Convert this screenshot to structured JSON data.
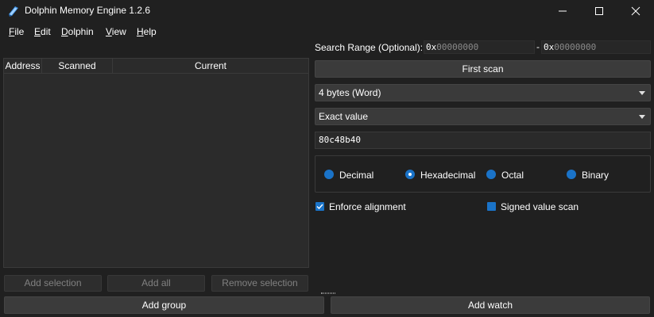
{
  "window": {
    "title": "Dolphin Memory Engine 1.2.6",
    "app_icon": "dolphin-memory-engine-icon",
    "controls": [
      "minimize-icon",
      "maximize-icon",
      "close-icon"
    ]
  },
  "menu": {
    "items": [
      "File",
      "Edit",
      "Dolphin",
      "View",
      "Help"
    ]
  },
  "scan_results_table": {
    "columns": [
      "Address",
      "Scanned",
      "Current"
    ],
    "rows": []
  },
  "left_buttons": {
    "add_selection": "Add selection",
    "add_all": "Add all",
    "remove_selection": "Remove selection"
  },
  "search_range": {
    "label": "Search Range (Optional):",
    "start_prefix": "0x",
    "start_placeholder": "00000000",
    "separator": "-",
    "end_prefix": "0x",
    "end_placeholder": "00000000"
  },
  "scan": {
    "first_scan_label": "First scan",
    "type_selected": "4 bytes (Word)",
    "filter_selected": "Exact value",
    "value": "80c48b40"
  },
  "base": {
    "options": [
      "Decimal",
      "Hexadecimal",
      "Octal",
      "Binary"
    ],
    "selected": "Hexadecimal"
  },
  "options": {
    "enforce_alignment": "Enforce alignment",
    "enforce_alignment_checked": true,
    "signed_value_scan": "Signed value scan",
    "signed_value_scan_checked": false
  },
  "bottom_buttons": {
    "add_group": "Add group",
    "add_watch": "Add watch"
  },
  "colors": {
    "background": "#202020",
    "accent": "#1a73c8",
    "button": "#3b3b3b"
  }
}
